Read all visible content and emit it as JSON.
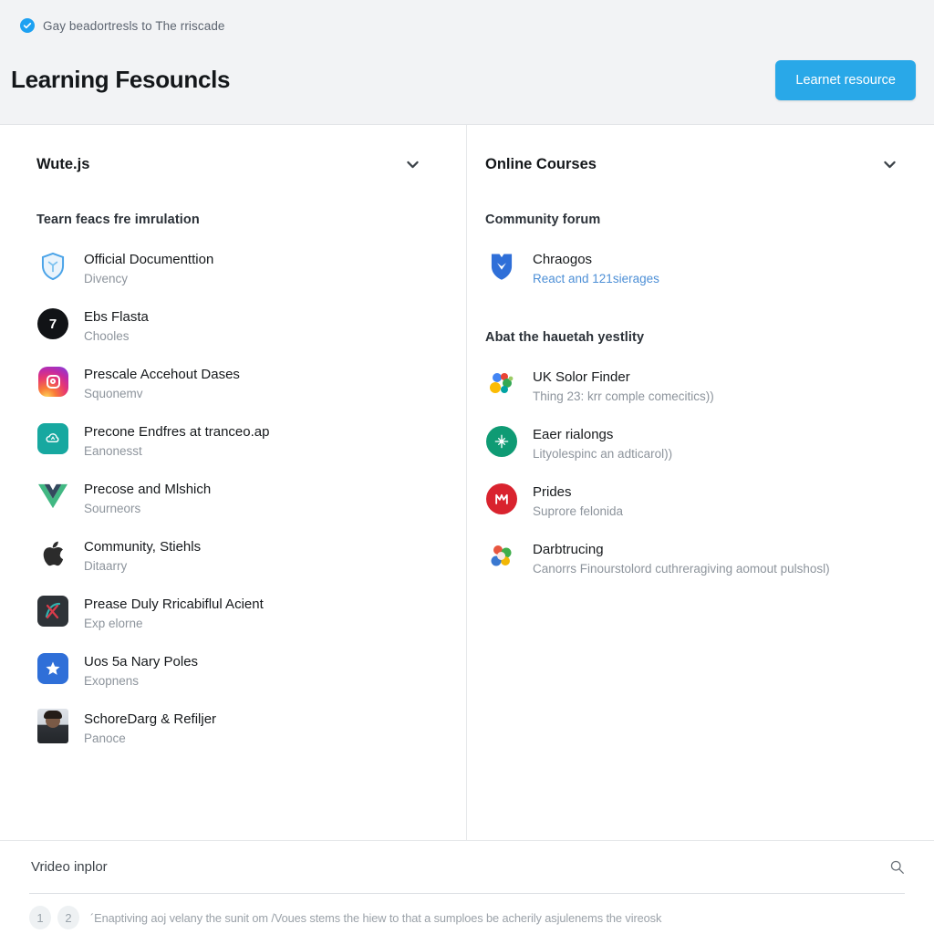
{
  "header": {
    "breadcrumb": "Gay beadortresls to The rriscade",
    "breadcrumb_icon": "check-circle-icon",
    "title": "Learning Fesouncls",
    "action_button": "Learnet resource",
    "accent_color": "#29a8e8",
    "background": "#f2f3f5"
  },
  "left_column": {
    "title": "Wute.js",
    "collapse_icon": "chevron-down-icon",
    "section_label": "Tearn feacs fre imrulation",
    "items": [
      {
        "title": "Official Documenttion",
        "subtitle": "Divency",
        "icon": "shield-icon",
        "icon_color": "#4aa3e8"
      },
      {
        "title": "Ebs Flasta",
        "subtitle": "Chooles",
        "icon": "number-badge-icon",
        "icon_color": "#111316",
        "badge": "7"
      },
      {
        "title": "Prescale Accehout Dases",
        "subtitle": "Squonemv",
        "icon": "instagram-icon",
        "icon_color": "#e8396f"
      },
      {
        "title": "Precone Endfres at tranceo.ap",
        "subtitle": "Eanonesst",
        "icon": "cloud-icon",
        "icon_color": "#17a8a0"
      },
      {
        "title": "Precose and Mlshich",
        "subtitle": "Sourneors",
        "icon": "vue-logo-icon",
        "icon_color": "#41b883"
      },
      {
        "title": "Community, Stiehls",
        "subtitle": "Ditaarry",
        "icon": "apple-icon",
        "icon_color": "#2b2b2b"
      },
      {
        "title": "Prease Duly Rricabiflul Acient",
        "subtitle": "Exp elorne",
        "icon": "xcode-icon",
        "icon_color": "#2e3338"
      },
      {
        "title": "Uos 5a Nary Poles",
        "subtitle": "Exopnens",
        "icon": "star-app-icon",
        "icon_color": "#2f6fd8"
      },
      {
        "title": "SchoreDarg & Refiljer",
        "subtitle": "Panoce",
        "icon": "user-avatar-icon",
        "icon_color": "#7a5a46"
      }
    ]
  },
  "right_column": {
    "title": "Online Courses",
    "collapse_icon": "chevron-down-icon",
    "section_label_1": "Community forum",
    "section_label_2": "Abat the hauetah yestlity",
    "featured": {
      "title": "Chraogos",
      "subtitle": "React and 121sierages",
      "icon": "shield-fold-icon",
      "icon_color": "#2f6fd8",
      "subtitle_is_link": true
    },
    "items": [
      {
        "title": "UK Solor Finder",
        "subtitle": "Thing 23: krr comple comecitics))",
        "icon": "color-dots-icon",
        "icon_color": "#f2b705"
      },
      {
        "title": "Eaer rialongs",
        "subtitle": "Lityolespinc an adticarol))",
        "icon": "compass-circle-icon",
        "icon_color": "#0f9b74"
      },
      {
        "title": "Prides",
        "subtitle": "Suprore felonida",
        "icon": "m-circle-icon",
        "icon_color": "#d9232e"
      },
      {
        "title": "Darbtrucing",
        "subtitle": "Canorrs Finourstolord cuthreragiving aomout pulshosl)",
        "icon": "color-petals-icon",
        "icon_color": "#e8563f"
      }
    ]
  },
  "footer": {
    "search_value": "Vrideo inplor",
    "search_placeholder": "Vrideo inplor",
    "search_icon": "search-icon",
    "pills": [
      "1",
      "2"
    ],
    "note": "´Enaptiving aoj velany the sunit om /Voues stems the hiew to that a sumploes be acherily asjulenems the vireosk"
  }
}
